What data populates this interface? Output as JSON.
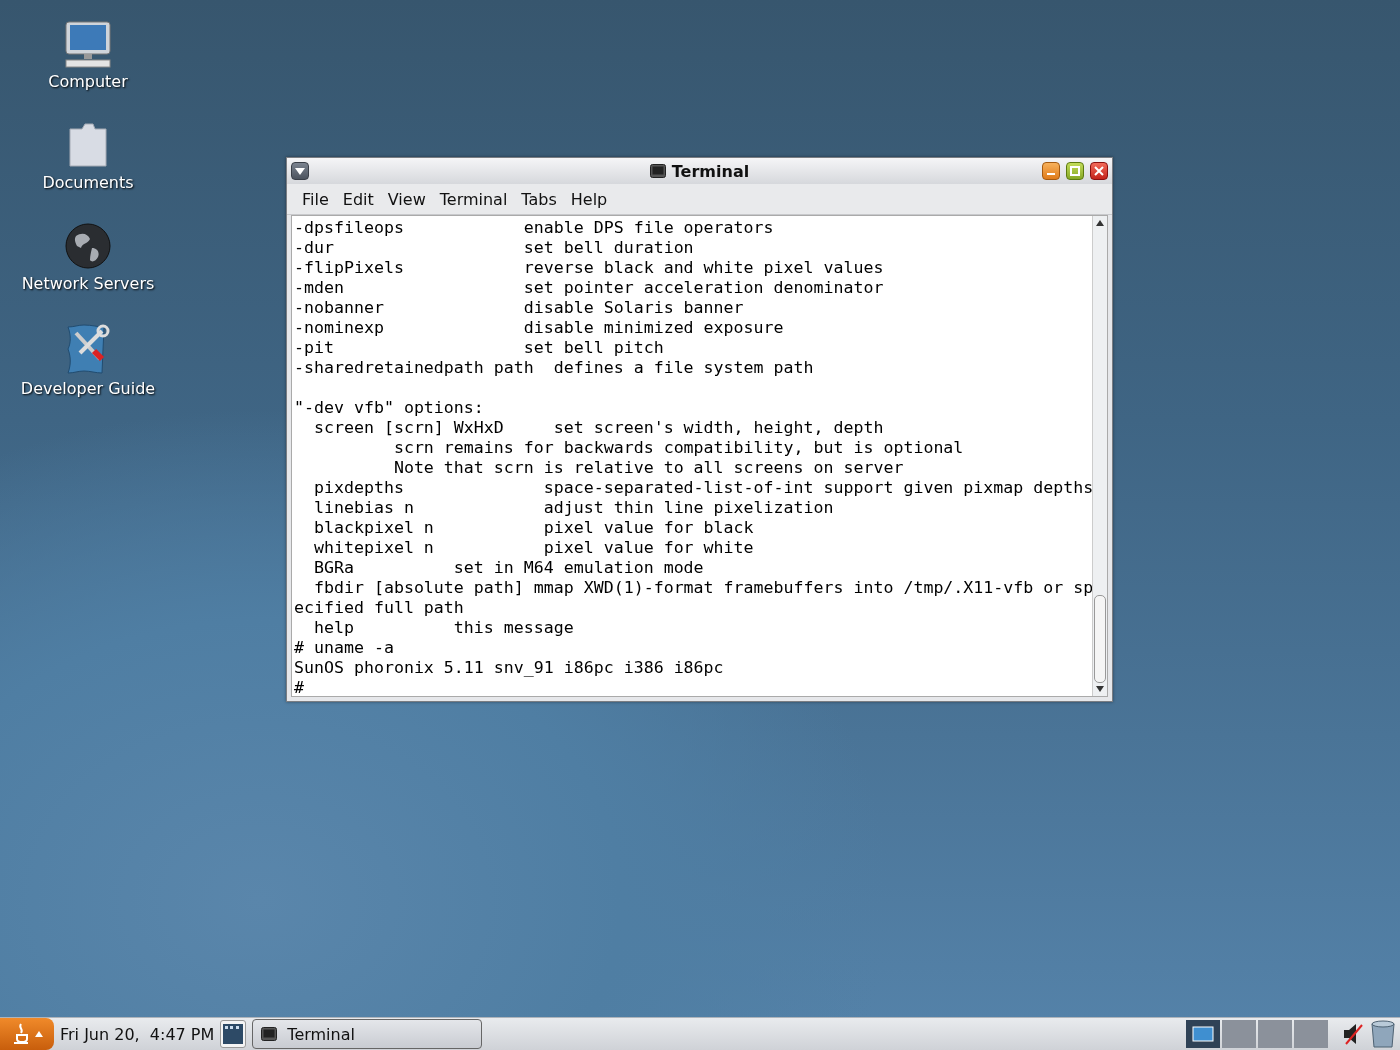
{
  "desktop_icons": [
    {
      "kind": "computer",
      "label": "Computer"
    },
    {
      "kind": "folder",
      "label": "Documents"
    },
    {
      "kind": "globe",
      "label": "Network Servers"
    },
    {
      "kind": "tools",
      "label": "Developer Guide"
    }
  ],
  "window": {
    "title": "Terminal",
    "menu": [
      "File",
      "Edit",
      "View",
      "Terminal",
      "Tabs",
      "Help"
    ],
    "lines": [
      "-dpsfileops            enable DPS file operators",
      "-dur                   set bell duration",
      "-flipPixels            reverse black and white pixel values",
      "-mden                  set pointer acceleration denominator",
      "-nobanner              disable Solaris banner",
      "-nominexp              disable minimized exposure",
      "-pit                   set bell pitch",
      "-sharedretainedpath path  defines a file system path"
    ],
    "vfb_lines": [
      "\"-dev vfb\" options:",
      "  screen [scrn] WxHxD     set screen's width, height, depth",
      "          scrn remains for backwards compatibility, but is optional",
      "          Note that scrn is relative to all screens on server",
      "  pixdepths              space-separated-list-of-int support given pixmap depths",
      "  linebias n             adjust thin line pixelization",
      "  blackpixel n           pixel value for black",
      "  whitepixel n           pixel value for white",
      "  BGRa          set in M64 emulation mode",
      "  fbdir [absolute path] mmap XWD(1)-format framebuffers into /tmp/.X11-vfb or sp",
      "ecified full path",
      "  help          this message",
      "# uname -a",
      "SunOS phoronix 5.11 snv_91 i86pc i386 i86pc",
      "#"
    ]
  },
  "taskbar": {
    "clock": "Fri Jun 20,  4:47 PM",
    "tasks": [
      {
        "label": "Terminal",
        "selected": false
      }
    ],
    "workspaces": [
      {
        "selected": true
      },
      {
        "selected": false
      },
      {
        "selected": false
      },
      {
        "selected": false
      }
    ],
    "volume_muted": true
  }
}
